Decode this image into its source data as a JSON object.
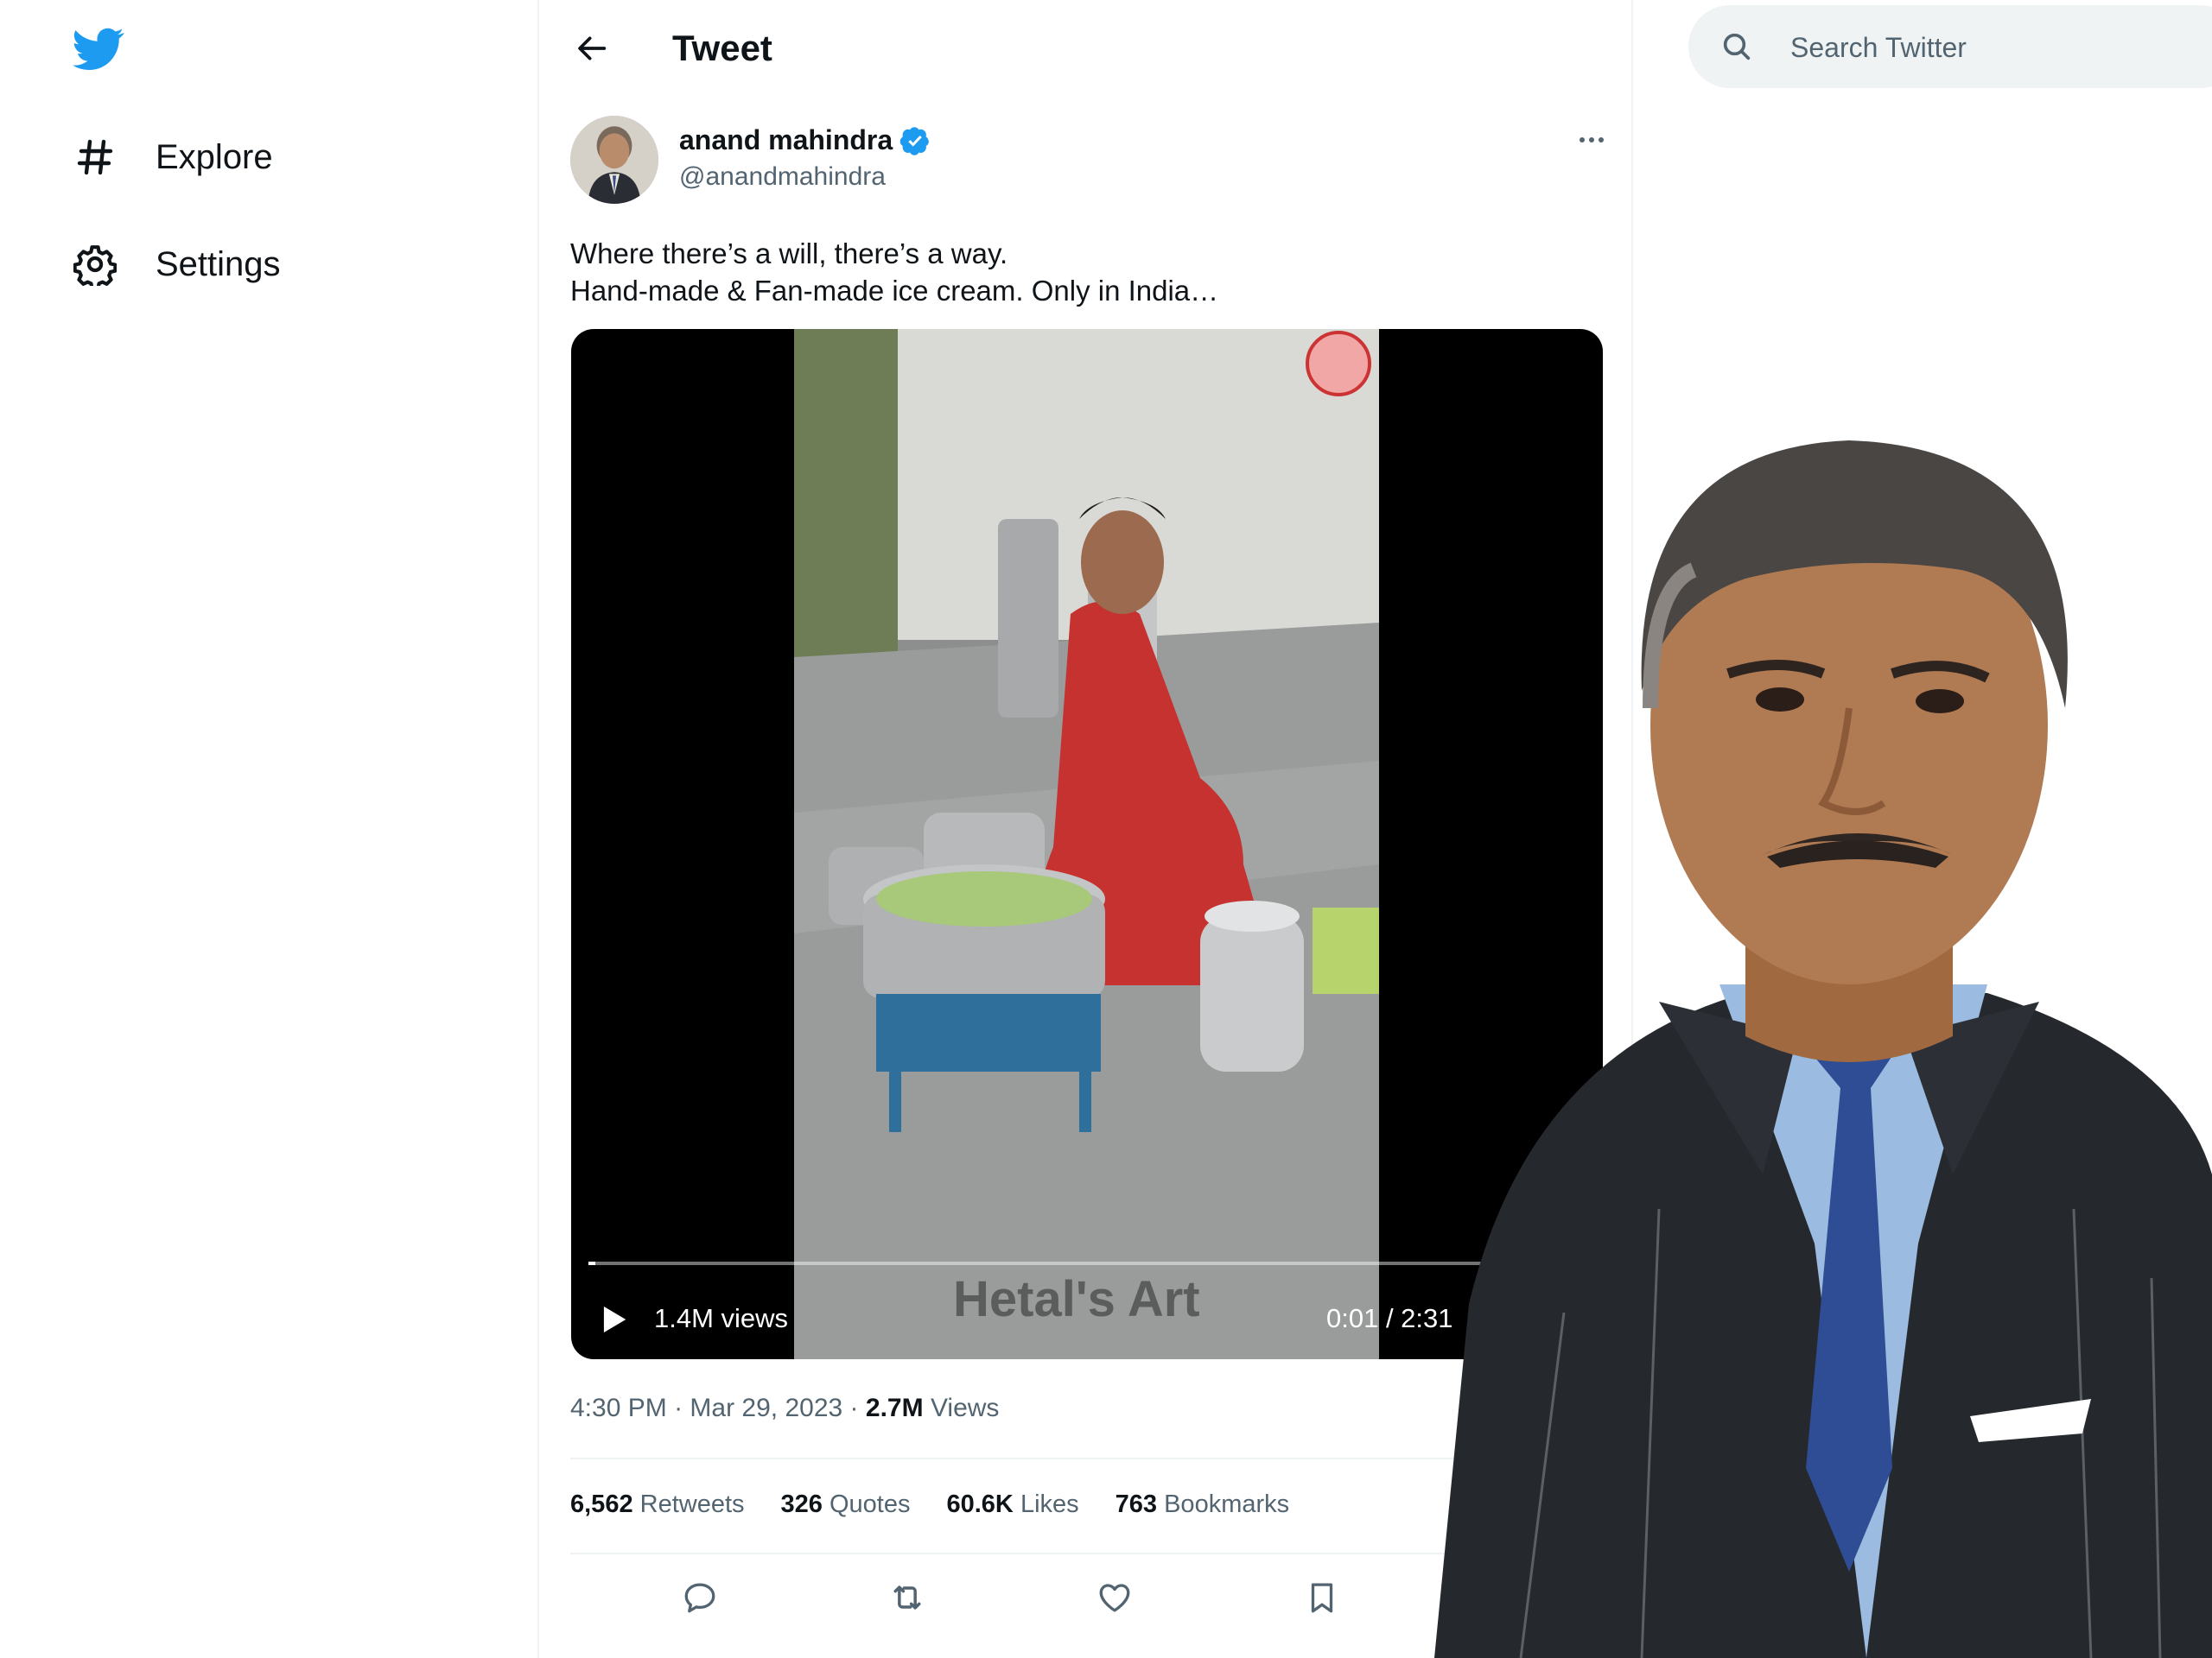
{
  "nav": {
    "items": [
      {
        "label": "Explore",
        "icon": "hashtag-icon"
      },
      {
        "label": "Settings",
        "icon": "gear-icon"
      }
    ]
  },
  "header": {
    "title": "Tweet"
  },
  "tweet": {
    "author_name": "anand mahindra",
    "author_handle": "@anandmahindra",
    "text_line1": "Where there’s a will, there’s a way.",
    "text_line2": "Hand-made & Fan-made ice cream. Only in India…",
    "video": {
      "views": "1.4M views",
      "time": "0:01 / 2:31",
      "progress": 0.007,
      "watermark": "Hetal's Art"
    },
    "meta": {
      "time": "4:30 PM",
      "date": "Mar 29, 2023",
      "views_count": "2.7M",
      "views_label": "Views",
      "separator": "·"
    },
    "stats": [
      {
        "count": "6,562",
        "label": "Retweets"
      },
      {
        "count": "326",
        "label": "Quotes"
      },
      {
        "count": "60.6K",
        "label": "Likes"
      },
      {
        "count": "763",
        "label": "Bookmarks"
      }
    ]
  },
  "search": {
    "placeholder": "Search Twitter"
  },
  "colors": {
    "accent": "#1d9bf0",
    "text": "#0f1419",
    "muted": "#536471",
    "border": "#eff3f4"
  }
}
